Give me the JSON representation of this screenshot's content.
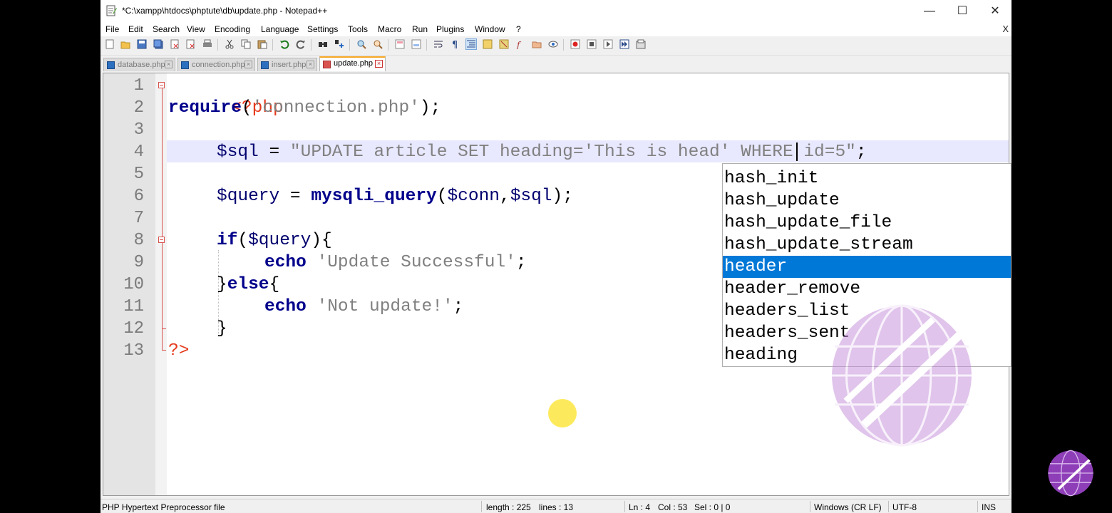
{
  "window": {
    "title": "*C:\\xampp\\htdocs\\phptute\\db\\update.php - Notepad++",
    "minimize_glyph": "—",
    "maximize_glyph": "☐",
    "close_glyph": "✕"
  },
  "menu": {
    "items": [
      "File",
      "Edit",
      "Search",
      "View",
      "Encoding",
      "Language",
      "Settings",
      "Tools",
      "Macro",
      "Run",
      "Plugins",
      "Window",
      "?"
    ],
    "close_label": "X"
  },
  "toolbar": {
    "icons": [
      "new-file-icon",
      "open-file-icon",
      "save-icon",
      "save-all-icon",
      "close-icon",
      "close-all-icon",
      "print-icon",
      "cut-icon",
      "copy-icon",
      "paste-icon",
      "undo-icon",
      "redo-icon",
      "find-icon",
      "replace-icon",
      "zoom-in-icon",
      "zoom-out-icon",
      "sync-vertical-icon",
      "sync-horizontal-icon",
      "word-wrap-icon",
      "show-all-chars-icon",
      "indent-guide-icon",
      "user-language-icon",
      "doc-map-icon",
      "function-list-icon",
      "folder-workspace-icon",
      "monitoring-icon",
      "record-macro-icon",
      "stop-macro-icon",
      "play-macro-icon",
      "run-macro-multiple-icon",
      "save-macro-icon"
    ]
  },
  "tabs": [
    {
      "label": "database.php",
      "active": false
    },
    {
      "label": "connection.php",
      "active": false
    },
    {
      "label": "insert.php",
      "active": false
    },
    {
      "label": "update.php",
      "active": true
    }
  ],
  "editor": {
    "line_numbers": [
      "1",
      "2",
      "3",
      "4",
      "5",
      "6",
      "7",
      "8",
      "9",
      "10",
      "11",
      "12",
      "13"
    ],
    "current_line": 4,
    "code": {
      "l1_tag": "<?php",
      "l2_kw": "require",
      "l2_open": "(",
      "l2_str": "'connection.php'",
      "l2_close": ");",
      "l4_var": "$sql",
      "l4_eq": " = ",
      "l4_str_a": "\"UPDATE article SET heading='This is head",
      "l4_str_b": "' WHERE id=5\"",
      "l4_semi": ";",
      "l6_var": "$query",
      "l6_eq": " = ",
      "l6_fn": "mysqli_query",
      "l6_open": "(",
      "l6_var2": "$conn",
      "l6_comma": ",",
      "l6_var3": "$sql",
      "l6_close": ");",
      "l8_kw": "if",
      "l8_open": "(",
      "l8_var": "$query",
      "l8_close": "){",
      "l9_kw": "echo",
      "l9_sp": " ",
      "l9_str": "'Update Successful'",
      "l9_semi": ";",
      "l10_brace": "}",
      "l10_kw": "else",
      "l10_open": "{",
      "l11_kw": "echo",
      "l11_sp": " ",
      "l11_str": "'Not update!'",
      "l11_semi": ";",
      "l12_brace": "}",
      "l13_tag": "?>"
    }
  },
  "autocomplete": {
    "items": [
      "hash_init",
      "hash_update",
      "hash_update_file",
      "hash_update_stream",
      "header",
      "header_remove",
      "headers_list",
      "headers_sent",
      "heading"
    ],
    "selected": "header"
  },
  "statusbar": {
    "file_type": "PHP Hypertext Preprocessor file",
    "length": "length : 225",
    "lines": "lines : 13",
    "ln": "Ln : 4",
    "col": "Col : 53",
    "sel": "Sel : 0 | 0",
    "eol": "Windows (CR LF)",
    "encoding": "UTF-8",
    "mode": "INS"
  },
  "colors": {
    "keyword": "#00008b",
    "string": "#808080",
    "php_tag": "#e53a1c",
    "selection": "#0078d7",
    "current_line": "#e8e8ff"
  }
}
